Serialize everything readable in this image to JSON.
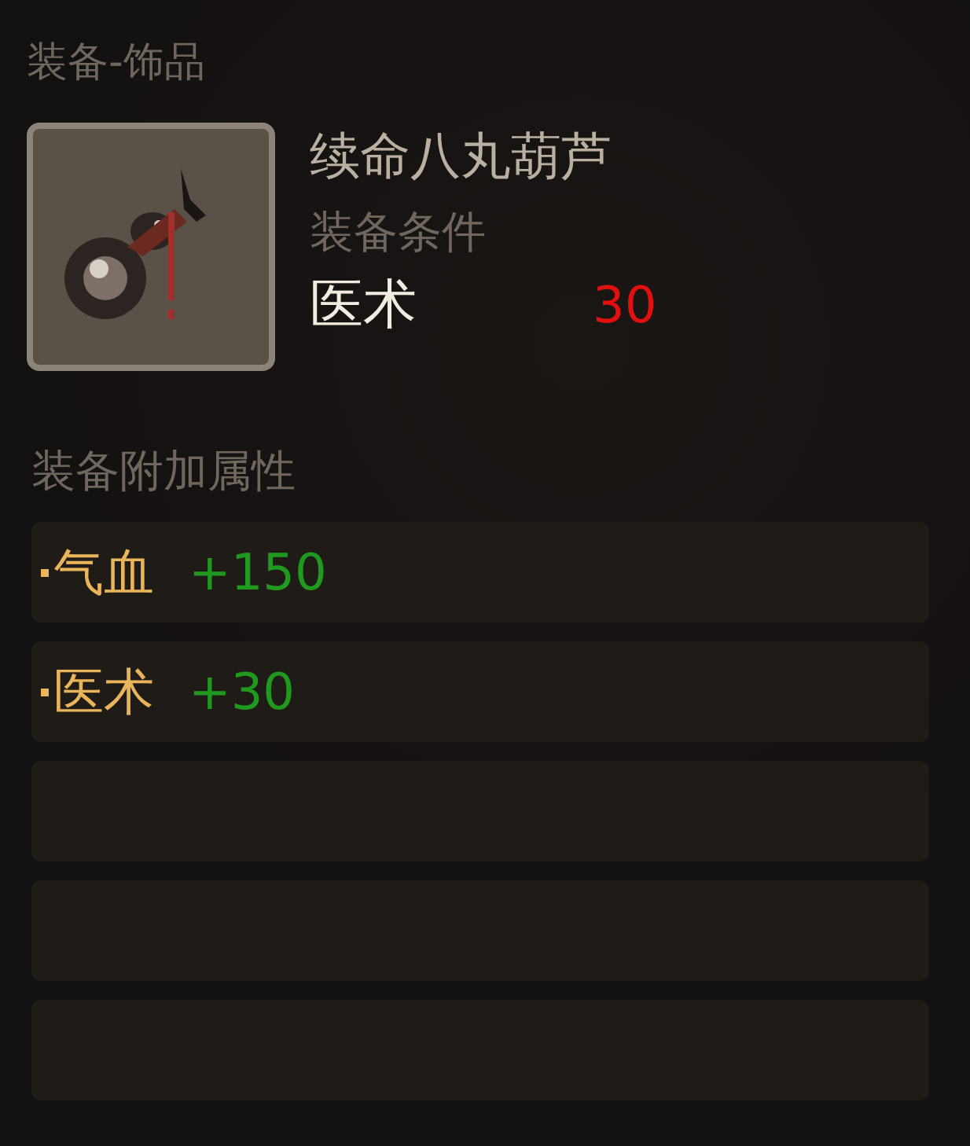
{
  "category": "装备-饰品",
  "item": {
    "name": "续命八丸葫芦",
    "requirements_label": "装备条件",
    "requirement": {
      "stat": "医术",
      "value": "30",
      "met": false
    }
  },
  "attributes_title": "装备附加属性",
  "attribute_slots": [
    {
      "kind": "stat",
      "name": "气血",
      "value": "+150"
    },
    {
      "kind": "stat",
      "name": "医术",
      "value": "+30"
    },
    {
      "kind": "empty"
    },
    {
      "kind": "empty"
    },
    {
      "kind": "empty"
    }
  ]
}
